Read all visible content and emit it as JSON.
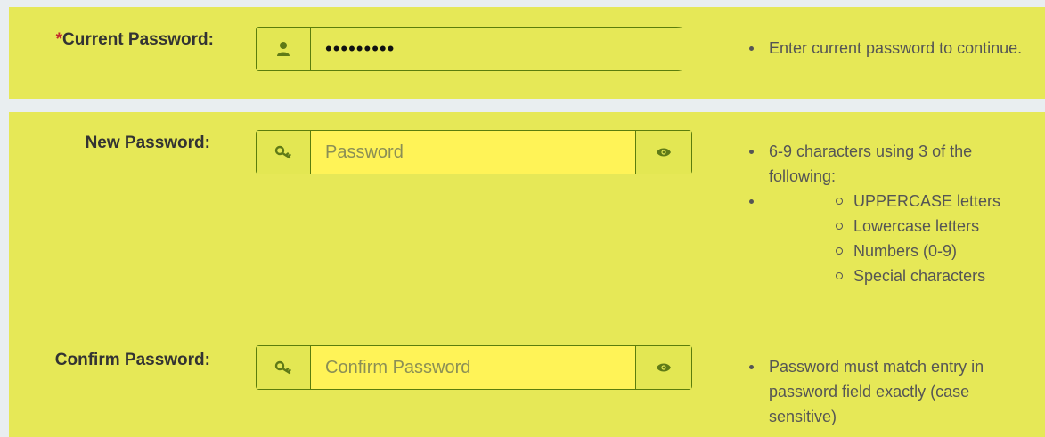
{
  "current": {
    "required_marker": "*",
    "label": "Current Password:",
    "value": "•••••••••",
    "icon": "user-icon",
    "help": [
      "Enter current password to continue."
    ]
  },
  "new_password": {
    "label": "New Password:",
    "placeholder": "Password",
    "icon": "key-icon",
    "toggle_icon": "eye-icon",
    "help_intro": "6-9 characters using 3 of the following:",
    "help_items": [
      "UPPERCASE letters",
      "Lowercase letters",
      "Numbers (0-9)",
      "Special characters"
    ]
  },
  "confirm_password": {
    "label": "Confirm Password:",
    "placeholder": "Confirm Password",
    "icon": "key-icon",
    "toggle_icon": "eye-icon",
    "help": [
      "Password must match entry in password field exactly (case sensitive)"
    ]
  },
  "colors": {
    "panel": "#e6e857",
    "input": "#fff357",
    "border": "#5b7d0c",
    "required": "#c2282c"
  }
}
